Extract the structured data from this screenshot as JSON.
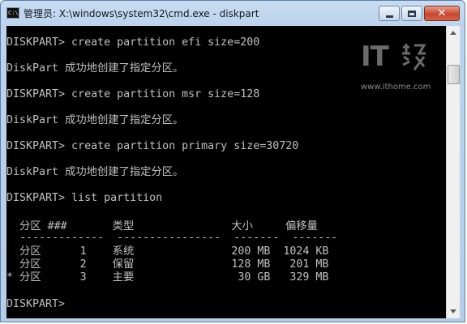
{
  "window": {
    "title": "管理员: X:\\windows\\system32\\cmd.exe - diskpart",
    "icon_label": "C:\\",
    "close_glyph": "✕"
  },
  "console": {
    "lines": [
      "DISKPART> create partition efi size=200",
      "DiskPart 成功地创建了指定分区。",
      "DISKPART> create partition msr size=128",
      "DiskPart 成功地创建了指定分区。",
      "DISKPART> create partition primary size=30720",
      "DiskPart 成功地创建了指定分区。",
      "DISKPART> list partition",
      "  分区 ###       类型               大小     偏移量",
      "  -------------  ----------------  -------  -------",
      "  分区      1    系统               200 MB  1024 KB",
      "  分区      2    保留               128 MB   201 MB",
      "* 分区      3    主要                30 GB   329 MB",
      "DISKPART>"
    ]
  },
  "watermark": {
    "logo": "IT",
    "url": "www.ithome.com"
  }
}
